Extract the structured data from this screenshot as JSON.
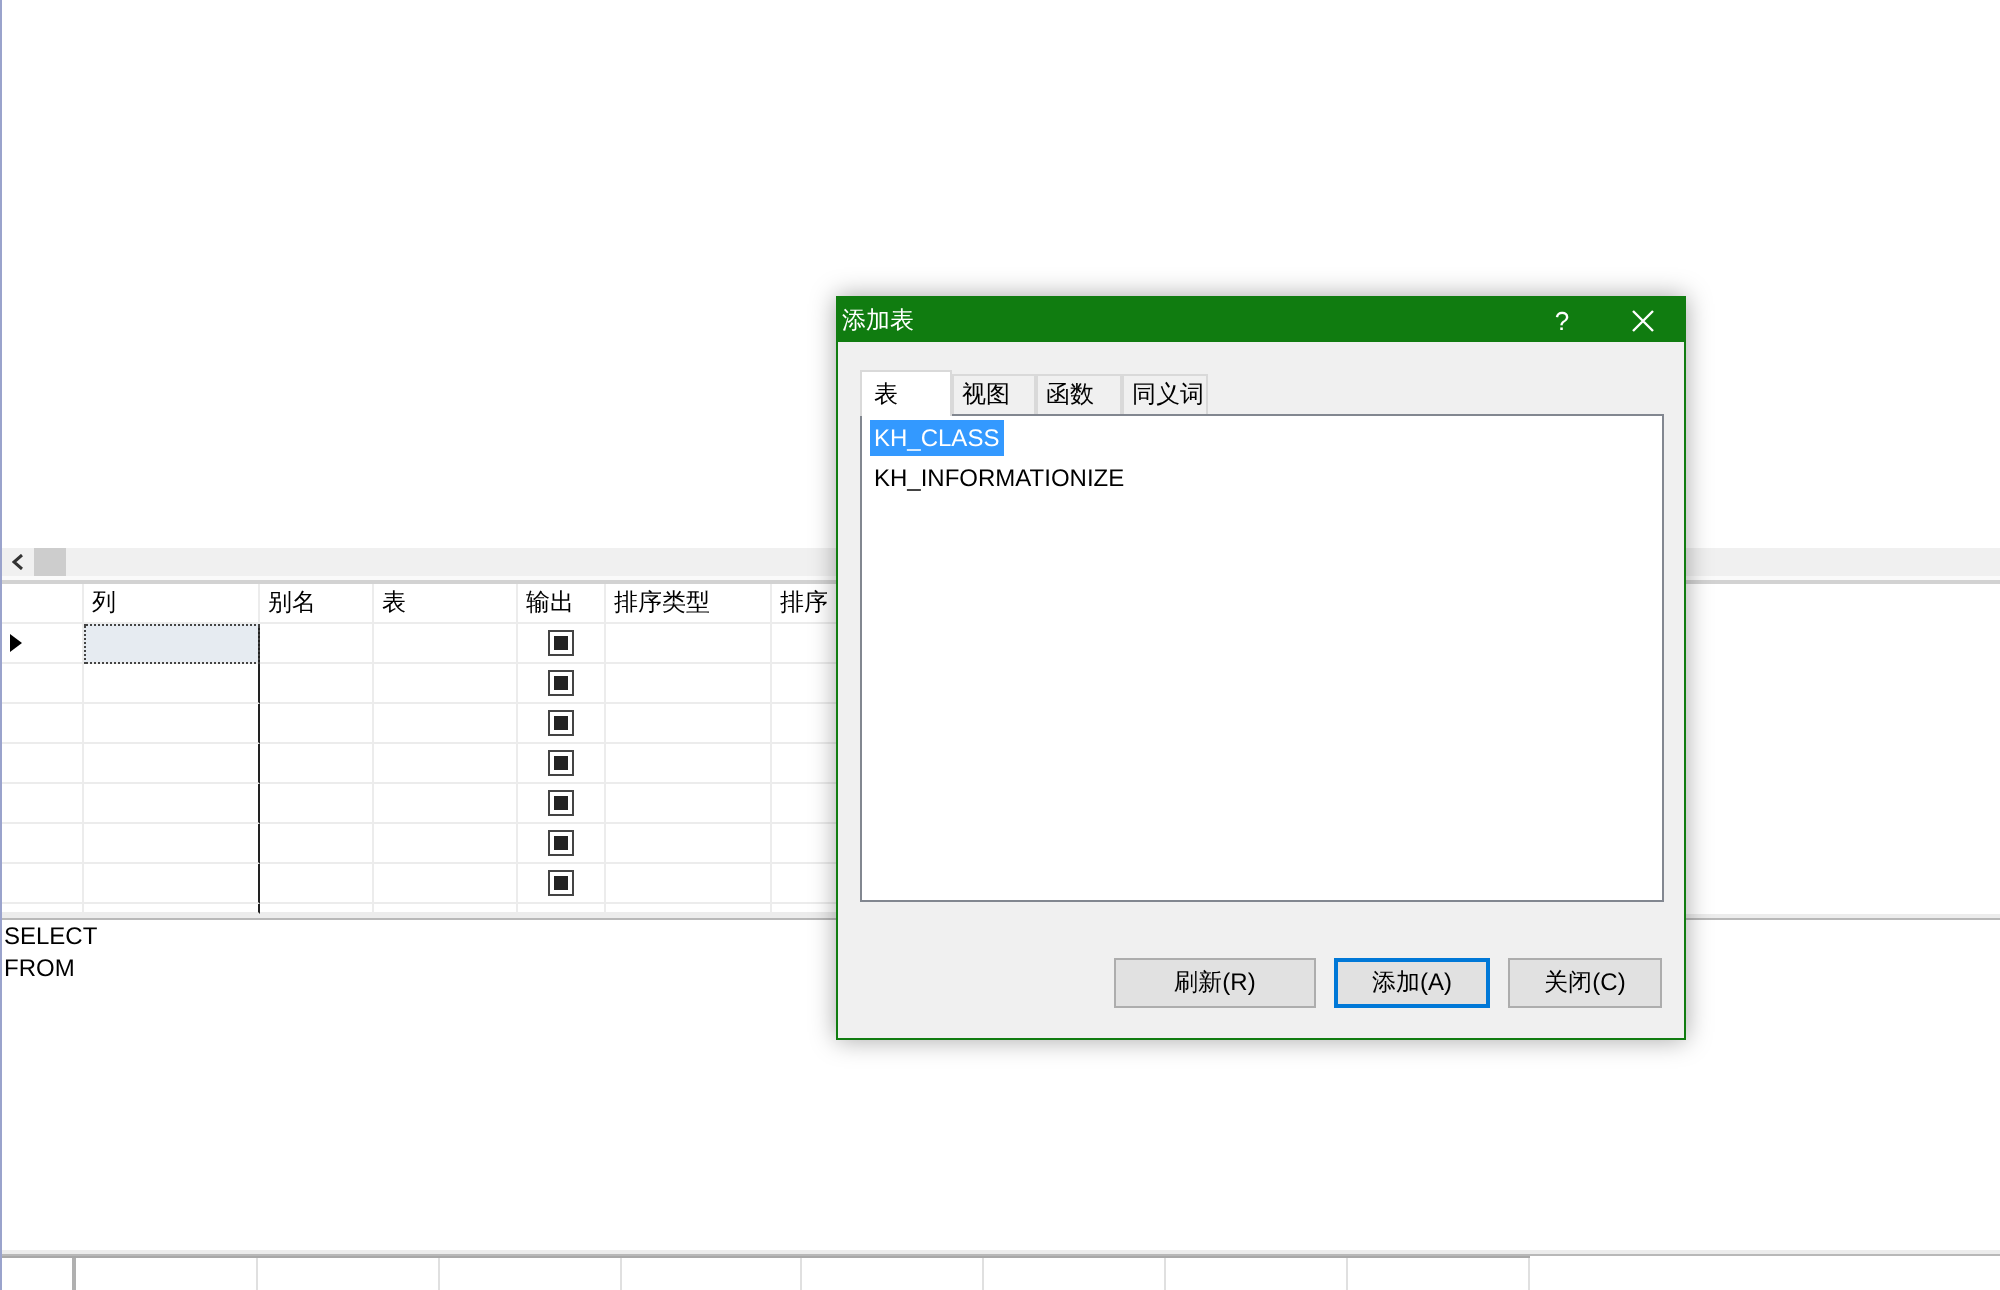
{
  "grid": {
    "columns": [
      {
        "label": "列",
        "kind": "text"
      },
      {
        "label": "别名",
        "kind": "text"
      },
      {
        "label": "表",
        "kind": "text"
      },
      {
        "label": "输出",
        "kind": "checkbox"
      },
      {
        "label": "排序类型",
        "kind": "text"
      },
      {
        "label": "排序",
        "kind": "text"
      }
    ],
    "rows": [
      {
        "current": true,
        "selected": true,
        "output": true
      },
      {
        "current": false,
        "selected": false,
        "output": true
      },
      {
        "current": false,
        "selected": false,
        "output": true
      },
      {
        "current": false,
        "selected": false,
        "output": true
      },
      {
        "current": false,
        "selected": false,
        "output": true
      },
      {
        "current": false,
        "selected": false,
        "output": true
      },
      {
        "current": false,
        "selected": false,
        "output": true
      }
    ]
  },
  "sql_pane": {
    "lines": [
      "SELECT",
      "FROM"
    ]
  },
  "dialog": {
    "title": "添加表",
    "help_label": "?",
    "tabs": [
      {
        "label": "表",
        "selected": true
      },
      {
        "label": "视图",
        "selected": false
      },
      {
        "label": "函数",
        "selected": false
      },
      {
        "label": "同义词",
        "selected": false
      }
    ],
    "list_items": [
      {
        "label": "KH_CLASS",
        "selected": true
      },
      {
        "label": "KH_INFORMATIONIZE",
        "selected": false
      }
    ],
    "buttons": [
      {
        "label": "刷新(R)",
        "default": false
      },
      {
        "label": "添加(A)",
        "default": true
      },
      {
        "label": "关闭(C)",
        "default": false
      }
    ]
  }
}
